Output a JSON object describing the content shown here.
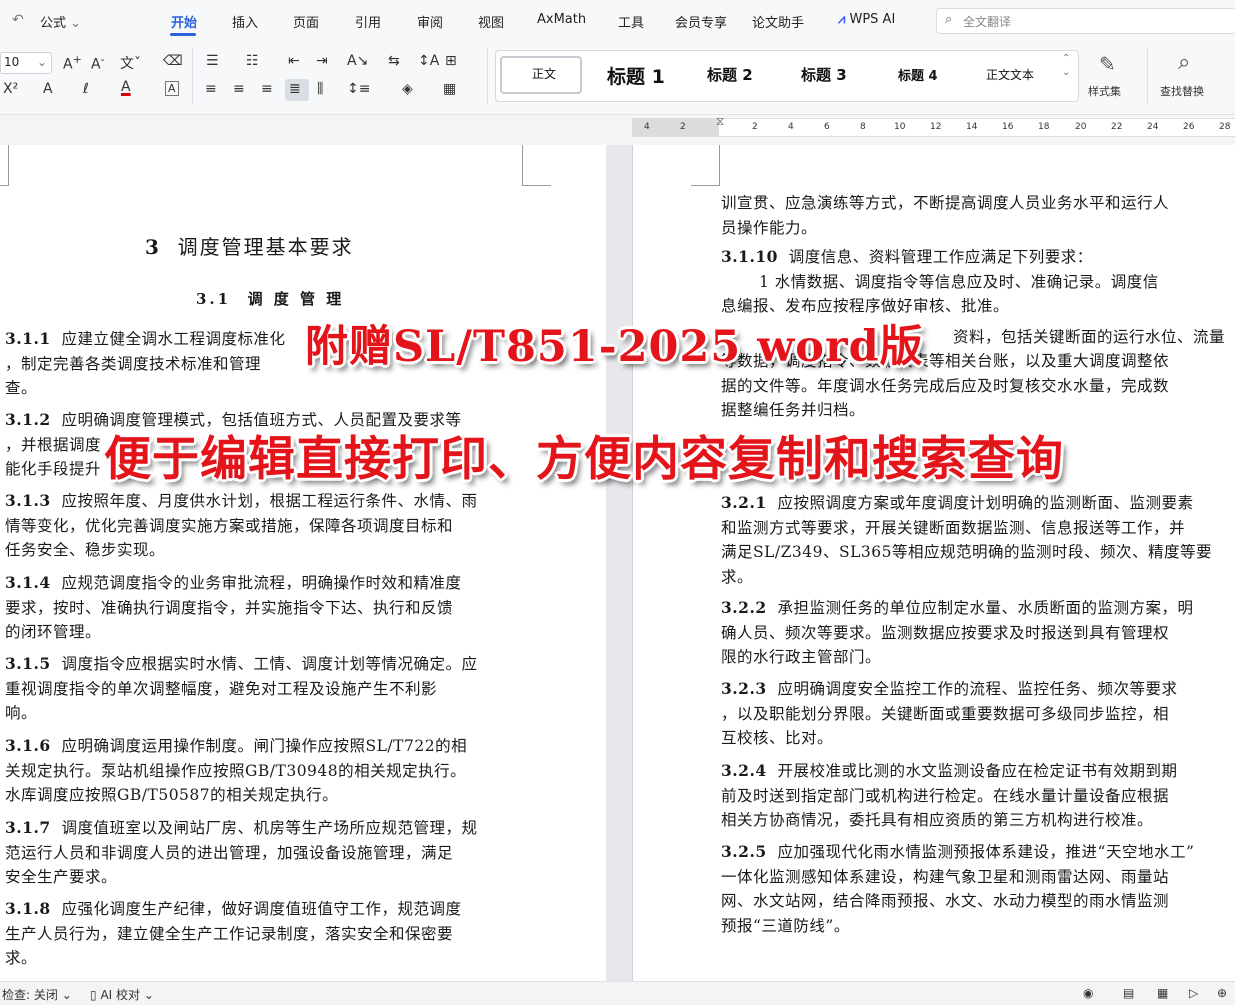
{
  "menu": {
    "style_label": "公式",
    "tabs": [
      "开始",
      "插入",
      "页面",
      "引用",
      "审阅",
      "视图",
      "AxMath",
      "工具",
      "会员专享",
      "论文助手"
    ],
    "wps_ai": "WPS AI",
    "search_placeholder": "全文翻译"
  },
  "ribbon": {
    "font_size": "10",
    "styles": [
      "正文",
      "标题 1",
      "标题 2",
      "标题 3",
      "标题 4",
      "正文文本"
    ],
    "styles_set_label": "样式集",
    "find_replace_label": "查找替换"
  },
  "ruler": [
    "4",
    "2",
    "2",
    "4",
    "6",
    "8",
    "10",
    "12",
    "14",
    "16",
    "18",
    "20",
    "22",
    "24",
    "26",
    "28"
  ],
  "left_page": {
    "chapter_num": "3",
    "chapter_title": "调度管理基本要求",
    "section_num": "3.1",
    "section_title": "调 度 管 理",
    "paragraphs": [
      {
        "num": "3.1.1",
        "lines": [
          "应建立健全调水工程调度标准化",
          "，制定完善各类调度技术标准和管理",
          "查。"
        ]
      },
      {
        "num": "3.1.2",
        "lines": [
          "应明确调度管理模式，包括值班方式、人员配置及要求等",
          "，并根据调度",
          "能化手段提升"
        ]
      },
      {
        "num": "3.1.3",
        "lines": [
          "应按照年度、月度供水计划，根据工程运行条件、水情、雨",
          "情等变化，优化完善调度实施方案或措施，保障各项调度目标和",
          "任务安全、稳步实现。"
        ]
      },
      {
        "num": "3.1.4",
        "lines": [
          "应规范调度指令的业务审批流程，明确操作时效和精准度",
          "要求，按时、准确执行调度指令，并实施指令下达、执行和反馈",
          "的闭环管理。"
        ]
      },
      {
        "num": "3.1.5",
        "lines": [
          "调度指令应根据实时水情、工情、调度计划等情况确定。应",
          "重视调度指令的单次调整幅度，避免对工程及设施产生不利影",
          "响。"
        ]
      },
      {
        "num": "3.1.6",
        "lines": [
          "应明确调度运用操作制度。闸门操作应按照SL/T722的相",
          "关规定执行。泵站机组操作应按照GB/T30948的相关规定执行。",
          "水库调度应按照GB/T50587的相关规定执行。"
        ]
      },
      {
        "num": "3.1.7",
        "lines": [
          "调度值班室以及闸站厂房、机房等生产场所应规范管理，规",
          "范运行人员和非调度人员的进出管理，加强设备设施管理，满足",
          "安全生产要求。"
        ]
      },
      {
        "num": "3.1.8",
        "lines": [
          "应强化调度生产纪律，做好调度值班值守工作，规范调度",
          "生产人员行为，建立健全生产工作记录制度，落实安全和保密要",
          "求。"
        ]
      }
    ]
  },
  "right_page": {
    "top_lines": [
      "训宣贯、应急演练等方式，不断提高调度人员业务水平和运行人",
      "员操作能力。"
    ],
    "p3110": {
      "num": "3.1.10",
      "lines": [
        "调度信息、资料管理工作应满足下列要求：",
        "1 水情数据、调度指令等信息应及时、准确记录。调度信",
        "息编报、发布应按程序做好审核、批准。",
        "资料，包括关键断面的运行水位、流量",
        "等数据，调度指令、数据报表等相关台账，以及重大调度调整依",
        "据的文件等。年度调水任务完成后应及时复核交水水量，完成数",
        "据整编任务并归档。"
      ]
    },
    "paragraphs": [
      {
        "num": "3.2.1",
        "lines": [
          "应按照调度方案或年度调度计划明确的监测断面、监测要素",
          "和监测方式等要求，开展关键断面数据监测、信息报送等工作，并",
          "满足SL/Z349、SL365等相应规范明确的监测时段、频次、精度等要",
          "求。"
        ]
      },
      {
        "num": "3.2.2",
        "lines": [
          "承担监测任务的单位应制定水量、水质断面的监测方案，明",
          "确人员、频次等要求。监测数据应按要求及时报送到具有管理权",
          "限的水行政主管部门。"
        ]
      },
      {
        "num": "3.2.3",
        "lines": [
          "应明确调度安全监控工作的流程、监控任务、频次等要求",
          "，以及职能划分界限。关键断面或重要数据可多级同步监控，相",
          "互校核、比对。"
        ]
      },
      {
        "num": "3.2.4",
        "lines": [
          "开展校准或比测的水文监测设备应在检定证书有效期到期",
          "前及时送到指定部门或机构进行检定。在线水量计量设备应根据",
          "相关方协商情况，委托具有相应资质的第三方机构进行校准。"
        ]
      },
      {
        "num": "3.2.5",
        "lines": [
          "应加强现代化雨水情监测预报体系建设，推进“天空地水工”",
          "一体化监测感知体系建设，构建气象卫星和测雨雷达网、雨量站",
          "网、水文站网，结合降雨预报、水文、水动力模型的雨水情监测",
          "预报“三道防线”。"
        ]
      }
    ]
  },
  "overlay": {
    "line1": "附赠SL/T851-2025 word版",
    "line2": "便于编辑直接打印、方便内容复制和搜索查询"
  },
  "status": {
    "check": "检查: 关闭",
    "ai_check": "AI 校对"
  }
}
